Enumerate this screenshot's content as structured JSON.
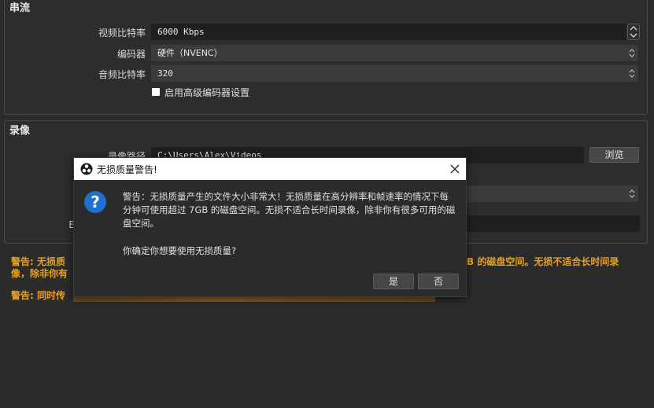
{
  "streaming": {
    "title": "串流",
    "video_bitrate_label": "视频比特率",
    "video_bitrate_value": "6000 Kbps",
    "encoder_label": "编码器",
    "encoder_value": "硬件（NVENC）",
    "audio_bitrate_label": "音频比特率",
    "audio_bitrate_value": "320",
    "advanced_checkbox_label": "启用高级编码器设置"
  },
  "recording": {
    "title": "录像",
    "path_label": "录像路径",
    "path_value": "C:\\Users\\Alex\\Videos",
    "browse_label": "浏览",
    "row4_label_fragment": "E"
  },
  "warnings": {
    "warn1_left_line1": "警告: 无损质",
    "warn1_left_line2": "像，除非你有",
    "warn1_right_line1": "B 的磁盘空间。无损不适合长时间录",
    "warn2_left": "警告: 同时传"
  },
  "dialog": {
    "title": "无损质量警告!",
    "icon": "question-icon",
    "message": "警告：无损质量产生的文件大小非常大！无损质量在高分辨率和帧速率的情况下每分钟可使用超过 7GB 的磁盘空间。无损不适合长时间录像，除非你有很多可用的磁盘空间。",
    "question": "你确定你想要使用无损质量?",
    "yes_label": "是",
    "no_label": "否",
    "close_icon": "close-icon"
  },
  "colors": {
    "warning": "#e8a021",
    "dialog_titlebar": "#ffffff",
    "question_icon": "#1f6fd1"
  }
}
